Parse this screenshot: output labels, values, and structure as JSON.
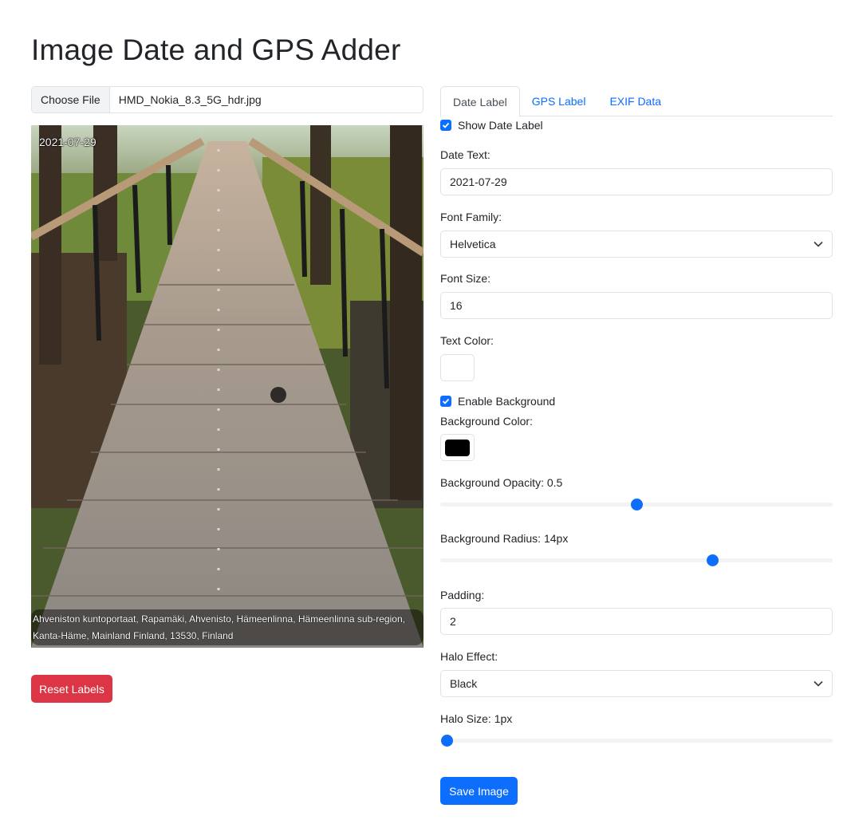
{
  "page": {
    "title": "Image Date and GPS Adder"
  },
  "file_input": {
    "button_label": "Choose File",
    "file_name": "HMD_Nokia_8.3_5G_hdr.jpg"
  },
  "preview": {
    "date_label": "2021-07-29",
    "gps_label_line1": "Ahveniston kuntoportaat, Rapamäki, Ahvenisto, Hämeenlinna, Hämeenlinna sub-region,",
    "gps_label_line2": "Kanta-Häme, Mainland Finland, 13530, Finland"
  },
  "reset_button": {
    "label": "Reset Labels"
  },
  "tabs": [
    {
      "label": "Date Label",
      "active": true
    },
    {
      "label": "GPS Label",
      "active": false
    },
    {
      "label": "EXIF Data",
      "active": false
    }
  ],
  "settings": {
    "show_date_label": {
      "label": "Show Date Label",
      "checked": true
    },
    "date_text": {
      "label": "Date Text:",
      "value": "2021-07-29"
    },
    "font_family": {
      "label": "Font Family:",
      "value": "Helvetica"
    },
    "font_size": {
      "label": "Font Size:",
      "value": "16"
    },
    "text_color": {
      "label": "Text Color:",
      "value": "#ffffff"
    },
    "enable_background": {
      "label": "Enable Background",
      "checked": true
    },
    "background_color": {
      "label": "Background Color:",
      "value": "#000000"
    },
    "background_opacity": {
      "label": "Background Opacity: 0.5",
      "value": 0.5,
      "min": 0,
      "max": 1
    },
    "background_radius": {
      "label": "Background Radius: 14px",
      "value": 14,
      "min": 0,
      "max": 20
    },
    "padding": {
      "label": "Padding:",
      "value": "2"
    },
    "halo_effect": {
      "label": "Halo Effect:",
      "value": "Black"
    },
    "halo_size": {
      "label": "Halo Size: 1px",
      "value": 1,
      "min": 1,
      "max": 10
    }
  },
  "save_button": {
    "label": "Save Image"
  },
  "colors": {
    "primary": "#0d6efd",
    "danger": "#dc3545",
    "border": "#dee2e6"
  },
  "icons": {
    "checkbox": "check-icon",
    "dropdown": "chevron-down-icon"
  }
}
